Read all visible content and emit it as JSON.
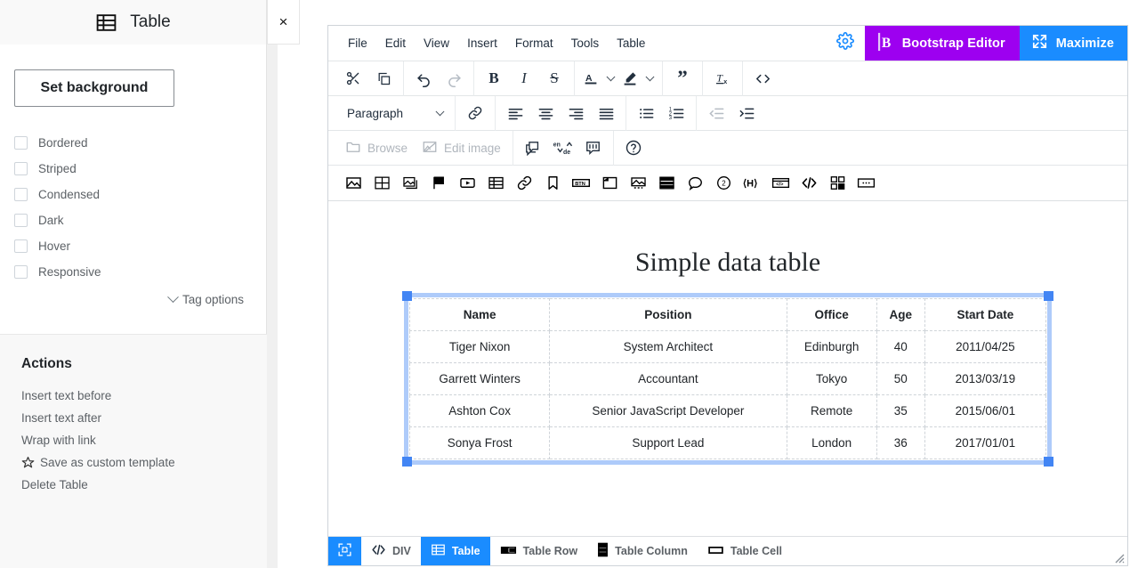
{
  "sidebar": {
    "header": {
      "title": "Table",
      "icon": "table-icon"
    },
    "close_label": "×",
    "set_background_label": "Set background",
    "checkboxes": [
      {
        "label": "Bordered",
        "checked": false
      },
      {
        "label": "Striped",
        "checked": false
      },
      {
        "label": "Condensed",
        "checked": false
      },
      {
        "label": "Dark",
        "checked": false
      },
      {
        "label": "Hover",
        "checked": false
      },
      {
        "label": "Responsive",
        "checked": false
      }
    ],
    "tag_options_label": "Tag options",
    "actions": {
      "title": "Actions",
      "items": [
        {
          "label": "Insert text before",
          "icon": null
        },
        {
          "label": "Insert text after",
          "icon": null
        },
        {
          "label": "Wrap with link",
          "icon": null
        },
        {
          "label": "Save as custom template",
          "icon": "star-icon"
        },
        {
          "label": "Delete Table",
          "icon": null
        }
      ]
    }
  },
  "editor": {
    "menubar": {
      "items": [
        "File",
        "Edit",
        "View",
        "Insert",
        "Format",
        "Tools",
        "Table"
      ],
      "gear_icon": "gear-icon",
      "brand_label": "Bootstrap Editor",
      "brand_icon": "bootstrap-b-icon",
      "brand_color": "#9d00f0",
      "maximize_label": "Maximize",
      "maximize_icon": "maximize-arrows-icon",
      "maximize_color": "#1a8cff"
    },
    "toolbar1": [
      {
        "name": "cut-icon",
        "title": "Cut",
        "disabled": false
      },
      {
        "name": "copy-icon",
        "title": "Copy",
        "disabled": false
      },
      {
        "name": "undo-icon",
        "title": "Undo",
        "disabled": false
      },
      {
        "name": "redo-icon",
        "title": "Redo",
        "disabled": true
      },
      {
        "name": "bold-icon",
        "title": "Bold",
        "disabled": false
      },
      {
        "name": "italic-icon",
        "title": "Italic",
        "disabled": false
      },
      {
        "name": "strikethrough-icon",
        "title": "Strikethrough",
        "disabled": false
      },
      {
        "name": "text-color-icon",
        "title": "Text color",
        "disabled": false
      },
      {
        "name": "highlight-color-icon",
        "title": "Background color",
        "disabled": false
      },
      {
        "name": "blockquote-icon",
        "title": "Blockquote",
        "disabled": false
      },
      {
        "name": "clear-formatting-icon",
        "title": "Clear formatting",
        "disabled": false
      },
      {
        "name": "source-code-icon",
        "title": "Source code",
        "disabled": false
      }
    ],
    "toolbar2": {
      "block_format": "Paragraph",
      "buttons": [
        {
          "name": "link-icon",
          "title": "Insert link",
          "disabled": false
        },
        {
          "name": "align-left-icon",
          "title": "Align left",
          "disabled": false
        },
        {
          "name": "align-center-icon",
          "title": "Align center",
          "disabled": false
        },
        {
          "name": "align-right-icon",
          "title": "Align right",
          "disabled": false
        },
        {
          "name": "align-justify-icon",
          "title": "Justify",
          "disabled": false
        },
        {
          "name": "bullet-list-icon",
          "title": "Bullet list",
          "disabled": false
        },
        {
          "name": "numbered-list-icon",
          "title": "Numbered list",
          "disabled": false
        },
        {
          "name": "outdent-icon",
          "title": "Decrease indent",
          "disabled": true
        },
        {
          "name": "indent-icon",
          "title": "Increase indent",
          "disabled": false
        }
      ]
    },
    "toolbar3": {
      "browse_label": "Browse",
      "edit_image_label": "Edit image",
      "browse_icon": "folder-open-icon",
      "edit_image_icon": "image-edit-icon",
      "buttons": [
        {
          "name": "comment-icon",
          "title": "Comment"
        },
        {
          "name": "translate-icon",
          "title": "Translate",
          "text_top": "en",
          "text_bottom": "de"
        },
        {
          "name": "tune-icon",
          "title": "Settings"
        },
        {
          "name": "help-icon",
          "title": "Help"
        }
      ]
    },
    "iconbar": [
      {
        "name": "image-icon",
        "title": "Image"
      },
      {
        "name": "gallery-icon",
        "title": "Gallery"
      },
      {
        "name": "slider-icon",
        "title": "Slider"
      },
      {
        "name": "flag-icon",
        "title": "Flag"
      },
      {
        "name": "video-icon",
        "title": "Video"
      },
      {
        "name": "table-icon",
        "title": "Table"
      },
      {
        "name": "link-icon",
        "title": "Link"
      },
      {
        "name": "bookmark-icon",
        "title": "Bookmark"
      },
      {
        "name": "button-icon",
        "title": "Button",
        "text": "BTN"
      },
      {
        "name": "card-icon",
        "title": "Card"
      },
      {
        "name": "figure-icon",
        "title": "Figure"
      },
      {
        "name": "accordion-icon",
        "title": "Accordion"
      },
      {
        "name": "tooltip-icon",
        "title": "Tooltip"
      },
      {
        "name": "badge-icon",
        "title": "Badge",
        "text": "2"
      },
      {
        "name": "heading-icon",
        "title": "Heading",
        "text": "H"
      },
      {
        "name": "iframe-icon",
        "title": "Iframe"
      },
      {
        "name": "code-icon",
        "title": "Code"
      },
      {
        "name": "qr-icon",
        "title": "QR code"
      },
      {
        "name": "more-icon",
        "title": "More"
      }
    ],
    "statusbar": {
      "items": [
        {
          "label": "",
          "icon": "select-element-icon",
          "active": true
        },
        {
          "label": "DIV",
          "icon": "code-tag-icon",
          "active": false
        },
        {
          "label": "Table",
          "icon": "table-icon",
          "active": true
        },
        {
          "label": "Table Row",
          "icon": "table-row-icon",
          "active": false
        },
        {
          "label": "Table Column",
          "icon": "table-column-icon",
          "active": false
        },
        {
          "label": "Table Cell",
          "icon": "table-cell-icon",
          "active": false
        }
      ],
      "resize_grip_icon": "resize-grip-icon"
    }
  },
  "document": {
    "title": "Simple data table",
    "table": {
      "headers": [
        "Name",
        "Position",
        "Office",
        "Age",
        "Start Date"
      ],
      "rows": [
        [
          "Tiger Nixon",
          "System Architect",
          "Edinburgh",
          "40",
          "2011/04/25"
        ],
        [
          "Garrett Winters",
          "Accountant",
          "Tokyo",
          "50",
          "2013/03/19"
        ],
        [
          "Ashton Cox",
          "Senior JavaScript Developer",
          "Remote",
          "35",
          "2015/06/01"
        ],
        [
          "Sonya Frost",
          "Support Lead",
          "London",
          "36",
          "2017/01/01"
        ]
      ],
      "selected": true,
      "selection_color": "#4285f4"
    }
  }
}
